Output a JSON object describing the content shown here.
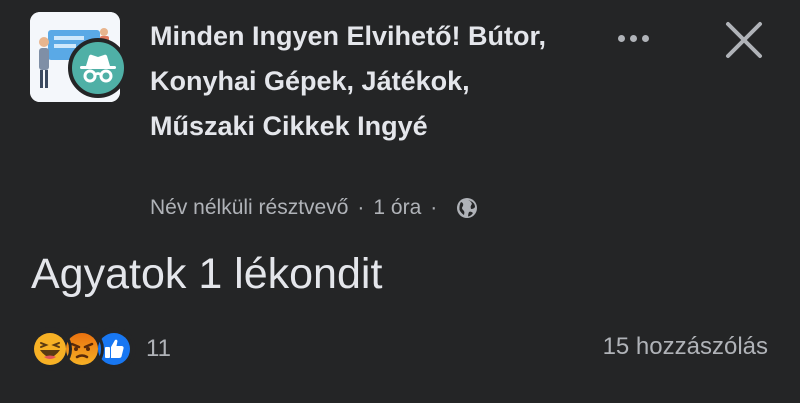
{
  "group": {
    "name": "Minden Ingyen Elvihető! Bútor, Konyhai Gépek, Játékok, Műszaki Cikkek Ingyé"
  },
  "post": {
    "author": "Név nélküli résztvevő",
    "separator": "·",
    "time": "1 óra",
    "text": "Agyatok 1 lékondit"
  },
  "footer": {
    "reaction_count": "11",
    "comment_count": "15 hozzászólás"
  },
  "colors": {
    "background": "#242526",
    "primary_text": "#e4e6eb",
    "secondary_text": "#b0b3b8",
    "like_blue": "#1877f2",
    "angry_orange": "#e9710f",
    "haha_yellow": "#f7b125",
    "anon_badge": "#4fb0a6"
  },
  "icons": {
    "more": "more-dots-icon",
    "close": "close-icon",
    "globe": "globe-icon",
    "anon": "incognito-icon",
    "reactions": [
      "haha-icon",
      "angry-icon",
      "like-icon"
    ]
  }
}
